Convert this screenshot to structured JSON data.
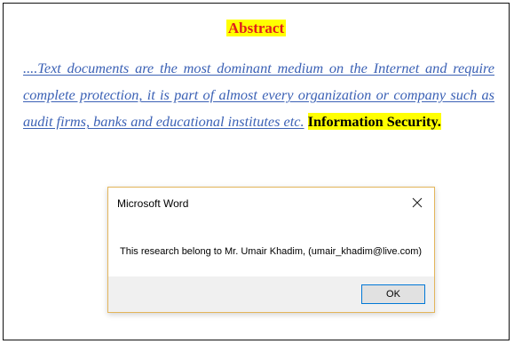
{
  "document": {
    "heading": "Abstract",
    "body_link_text": "....Text documents are the most dominant medium on the Internet and require complete protection, it is part of almost every organization or company such as audit firms, banks and educational institutes etc.",
    "body_highlight_text": "Information Security."
  },
  "dialog": {
    "title": "Microsoft Word",
    "message": "This research belong to Mr. Umair Khadim, (umair_khadim@live.com)",
    "ok_label": "OK",
    "close_icon": "close-icon"
  },
  "colors": {
    "heading_text": "#e11d1d",
    "highlight": "#ffff00",
    "link_text": "#3b61b5",
    "dialog_border": "#e3b55a",
    "dialog_footer": "#f0f0f0",
    "ok_border": "#0078d7"
  }
}
